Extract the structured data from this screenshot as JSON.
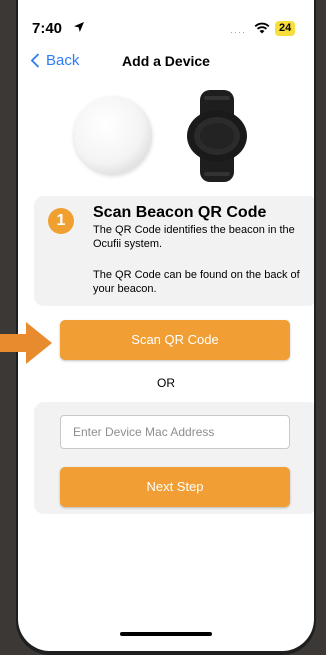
{
  "status_bar": {
    "time": "7:40",
    "battery": "24"
  },
  "nav": {
    "back_label": "Back",
    "title": "Add a Device"
  },
  "step": {
    "number": "1",
    "title": "Scan Beacon QR Code",
    "description": "The QR Code identifies the beacon in the Ocufii system.",
    "hint": "The QR Code can be found on the back of your beacon."
  },
  "scan_button": {
    "label": "Scan QR Code"
  },
  "divider_text": "OR",
  "mac_input": {
    "placeholder": "Enter Device Mac Address",
    "value": ""
  },
  "next_button": {
    "label": "Next Step"
  },
  "colors": {
    "accent_orange": "#f19f34",
    "link_blue": "#2f7cf6",
    "card_bg": "#f2f2f2",
    "battery_yellow": "#f7de3a"
  },
  "icons": [
    "location-arrow-icon",
    "wifi-icon",
    "chevron-left-icon",
    "beacon-image",
    "wristband-image",
    "pointer-arrow-icon"
  ]
}
